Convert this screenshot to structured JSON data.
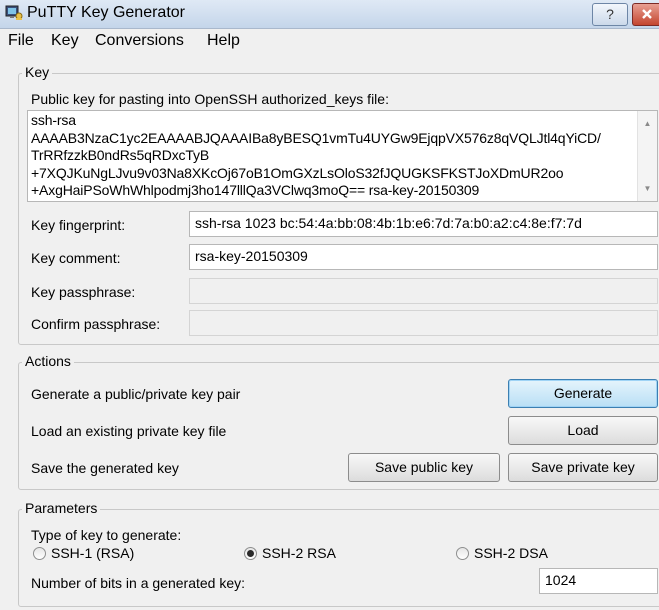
{
  "window": {
    "title": "PuTTY Key Generator",
    "help_button": "?"
  },
  "menu": [
    "File",
    "Key",
    "Conversions",
    "Help"
  ],
  "key_group": {
    "legend": "Key",
    "public_key_label": "Public key for pasting into OpenSSH authorized_keys file:",
    "public_key_lines": [
      "ssh-rsa",
      "AAAAB3NzaC1yc2EAAAABJQAAAIBa8yBESQ1vmTu4UYGw9EjqpVX576z8qVQLJtl4qYiCD/",
      "TrRRfzzkB0ndRs5qRDxcTyB",
      "+7XQJKuNgLJvu9v03Na8XKcOj67oB1OmGXzLsOloS32fJQUGKSFKSTJoXDmUR2oo",
      "+AxgHaiPSoWhWhlpodmj3ho147lllQa3VClwq3moQ== rsa-key-20150309"
    ],
    "fingerprint_label": "Key fingerprint:",
    "fingerprint_value": "ssh-rsa 1023 bc:54:4a:bb:08:4b:1b:e6:7d:7a:b0:a2:c4:8e:f7:7d",
    "comment_label": "Key comment:",
    "comment_value": "rsa-key-20150309",
    "passphrase_label": "Key passphrase:",
    "passphrase_value": "",
    "confirm_label": "Confirm passphrase:",
    "confirm_value": ""
  },
  "actions_group": {
    "legend": "Actions",
    "generate_label": "Generate a public/private key pair",
    "generate_button": "Generate",
    "load_label": "Load an existing private key file",
    "load_button": "Load",
    "save_label": "Save the generated key",
    "save_public_button": "Save public key",
    "save_private_button": "Save private key"
  },
  "params_group": {
    "legend": "Parameters",
    "type_label": "Type of key to generate:",
    "types": [
      {
        "label": "SSH-1 (RSA)",
        "selected": false
      },
      {
        "label": "SSH-2 RSA",
        "selected": true
      },
      {
        "label": "SSH-2 DSA",
        "selected": false
      }
    ],
    "bits_label": "Number of bits in a generated key:",
    "bits_value": "1024"
  },
  "colors": {
    "accent_button": "#b9dff5",
    "close_button": "#c4452f"
  }
}
